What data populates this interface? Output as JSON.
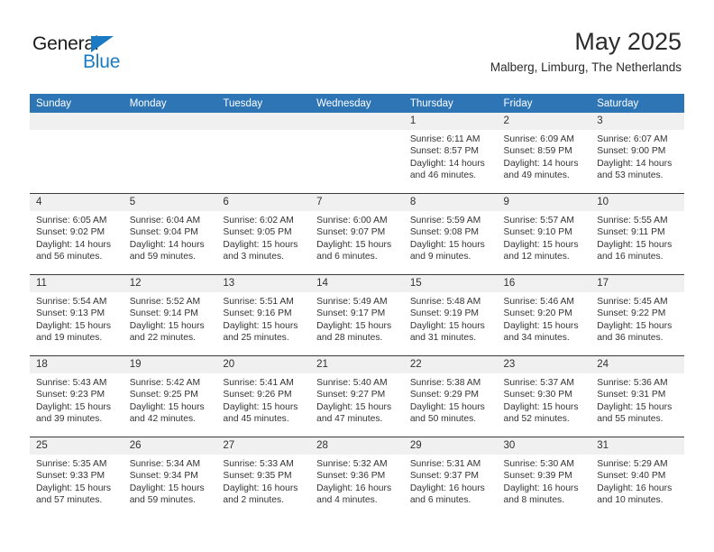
{
  "brand": {
    "name_top": "General",
    "name_bottom": "Blue",
    "accent_color": "#1a7bc4"
  },
  "header": {
    "title": "May 2025",
    "subtitle": "Malberg, Limburg, The Netherlands",
    "header_band_color": "#2e75b6"
  },
  "weekday_headers": [
    "Sunday",
    "Monday",
    "Tuesday",
    "Wednesday",
    "Thursday",
    "Friday",
    "Saturday"
  ],
  "weeks": [
    [
      {
        "day": "",
        "empty": true
      },
      {
        "day": "",
        "empty": true
      },
      {
        "day": "",
        "empty": true
      },
      {
        "day": "",
        "empty": true
      },
      {
        "day": "1",
        "sunrise": "Sunrise: 6:11 AM",
        "sunset": "Sunset: 8:57 PM",
        "daylight_1": "Daylight: 14 hours",
        "daylight_2": "and 46 minutes."
      },
      {
        "day": "2",
        "sunrise": "Sunrise: 6:09 AM",
        "sunset": "Sunset: 8:59 PM",
        "daylight_1": "Daylight: 14 hours",
        "daylight_2": "and 49 minutes."
      },
      {
        "day": "3",
        "sunrise": "Sunrise: 6:07 AM",
        "sunset": "Sunset: 9:00 PM",
        "daylight_1": "Daylight: 14 hours",
        "daylight_2": "and 53 minutes."
      }
    ],
    [
      {
        "day": "4",
        "sunrise": "Sunrise: 6:05 AM",
        "sunset": "Sunset: 9:02 PM",
        "daylight_1": "Daylight: 14 hours",
        "daylight_2": "and 56 minutes."
      },
      {
        "day": "5",
        "sunrise": "Sunrise: 6:04 AM",
        "sunset": "Sunset: 9:04 PM",
        "daylight_1": "Daylight: 14 hours",
        "daylight_2": "and 59 minutes."
      },
      {
        "day": "6",
        "sunrise": "Sunrise: 6:02 AM",
        "sunset": "Sunset: 9:05 PM",
        "daylight_1": "Daylight: 15 hours",
        "daylight_2": "and 3 minutes."
      },
      {
        "day": "7",
        "sunrise": "Sunrise: 6:00 AM",
        "sunset": "Sunset: 9:07 PM",
        "daylight_1": "Daylight: 15 hours",
        "daylight_2": "and 6 minutes."
      },
      {
        "day": "8",
        "sunrise": "Sunrise: 5:59 AM",
        "sunset": "Sunset: 9:08 PM",
        "daylight_1": "Daylight: 15 hours",
        "daylight_2": "and 9 minutes."
      },
      {
        "day": "9",
        "sunrise": "Sunrise: 5:57 AM",
        "sunset": "Sunset: 9:10 PM",
        "daylight_1": "Daylight: 15 hours",
        "daylight_2": "and 12 minutes."
      },
      {
        "day": "10",
        "sunrise": "Sunrise: 5:55 AM",
        "sunset": "Sunset: 9:11 PM",
        "daylight_1": "Daylight: 15 hours",
        "daylight_2": "and 16 minutes."
      }
    ],
    [
      {
        "day": "11",
        "sunrise": "Sunrise: 5:54 AM",
        "sunset": "Sunset: 9:13 PM",
        "daylight_1": "Daylight: 15 hours",
        "daylight_2": "and 19 minutes."
      },
      {
        "day": "12",
        "sunrise": "Sunrise: 5:52 AM",
        "sunset": "Sunset: 9:14 PM",
        "daylight_1": "Daylight: 15 hours",
        "daylight_2": "and 22 minutes."
      },
      {
        "day": "13",
        "sunrise": "Sunrise: 5:51 AM",
        "sunset": "Sunset: 9:16 PM",
        "daylight_1": "Daylight: 15 hours",
        "daylight_2": "and 25 minutes."
      },
      {
        "day": "14",
        "sunrise": "Sunrise: 5:49 AM",
        "sunset": "Sunset: 9:17 PM",
        "daylight_1": "Daylight: 15 hours",
        "daylight_2": "and 28 minutes."
      },
      {
        "day": "15",
        "sunrise": "Sunrise: 5:48 AM",
        "sunset": "Sunset: 9:19 PM",
        "daylight_1": "Daylight: 15 hours",
        "daylight_2": "and 31 minutes."
      },
      {
        "day": "16",
        "sunrise": "Sunrise: 5:46 AM",
        "sunset": "Sunset: 9:20 PM",
        "daylight_1": "Daylight: 15 hours",
        "daylight_2": "and 34 minutes."
      },
      {
        "day": "17",
        "sunrise": "Sunrise: 5:45 AM",
        "sunset": "Sunset: 9:22 PM",
        "daylight_1": "Daylight: 15 hours",
        "daylight_2": "and 36 minutes."
      }
    ],
    [
      {
        "day": "18",
        "sunrise": "Sunrise: 5:43 AM",
        "sunset": "Sunset: 9:23 PM",
        "daylight_1": "Daylight: 15 hours",
        "daylight_2": "and 39 minutes."
      },
      {
        "day": "19",
        "sunrise": "Sunrise: 5:42 AM",
        "sunset": "Sunset: 9:25 PM",
        "daylight_1": "Daylight: 15 hours",
        "daylight_2": "and 42 minutes."
      },
      {
        "day": "20",
        "sunrise": "Sunrise: 5:41 AM",
        "sunset": "Sunset: 9:26 PM",
        "daylight_1": "Daylight: 15 hours",
        "daylight_2": "and 45 minutes."
      },
      {
        "day": "21",
        "sunrise": "Sunrise: 5:40 AM",
        "sunset": "Sunset: 9:27 PM",
        "daylight_1": "Daylight: 15 hours",
        "daylight_2": "and 47 minutes."
      },
      {
        "day": "22",
        "sunrise": "Sunrise: 5:38 AM",
        "sunset": "Sunset: 9:29 PM",
        "daylight_1": "Daylight: 15 hours",
        "daylight_2": "and 50 minutes."
      },
      {
        "day": "23",
        "sunrise": "Sunrise: 5:37 AM",
        "sunset": "Sunset: 9:30 PM",
        "daylight_1": "Daylight: 15 hours",
        "daylight_2": "and 52 minutes."
      },
      {
        "day": "24",
        "sunrise": "Sunrise: 5:36 AM",
        "sunset": "Sunset: 9:31 PM",
        "daylight_1": "Daylight: 15 hours",
        "daylight_2": "and 55 minutes."
      }
    ],
    [
      {
        "day": "25",
        "sunrise": "Sunrise: 5:35 AM",
        "sunset": "Sunset: 9:33 PM",
        "daylight_1": "Daylight: 15 hours",
        "daylight_2": "and 57 minutes."
      },
      {
        "day": "26",
        "sunrise": "Sunrise: 5:34 AM",
        "sunset": "Sunset: 9:34 PM",
        "daylight_1": "Daylight: 15 hours",
        "daylight_2": "and 59 minutes."
      },
      {
        "day": "27",
        "sunrise": "Sunrise: 5:33 AM",
        "sunset": "Sunset: 9:35 PM",
        "daylight_1": "Daylight: 16 hours",
        "daylight_2": "and 2 minutes."
      },
      {
        "day": "28",
        "sunrise": "Sunrise: 5:32 AM",
        "sunset": "Sunset: 9:36 PM",
        "daylight_1": "Daylight: 16 hours",
        "daylight_2": "and 4 minutes."
      },
      {
        "day": "29",
        "sunrise": "Sunrise: 5:31 AM",
        "sunset": "Sunset: 9:37 PM",
        "daylight_1": "Daylight: 16 hours",
        "daylight_2": "and 6 minutes."
      },
      {
        "day": "30",
        "sunrise": "Sunrise: 5:30 AM",
        "sunset": "Sunset: 9:39 PM",
        "daylight_1": "Daylight: 16 hours",
        "daylight_2": "and 8 minutes."
      },
      {
        "day": "31",
        "sunrise": "Sunrise: 5:29 AM",
        "sunset": "Sunset: 9:40 PM",
        "daylight_1": "Daylight: 16 hours",
        "daylight_2": "and 10 minutes."
      }
    ]
  ]
}
